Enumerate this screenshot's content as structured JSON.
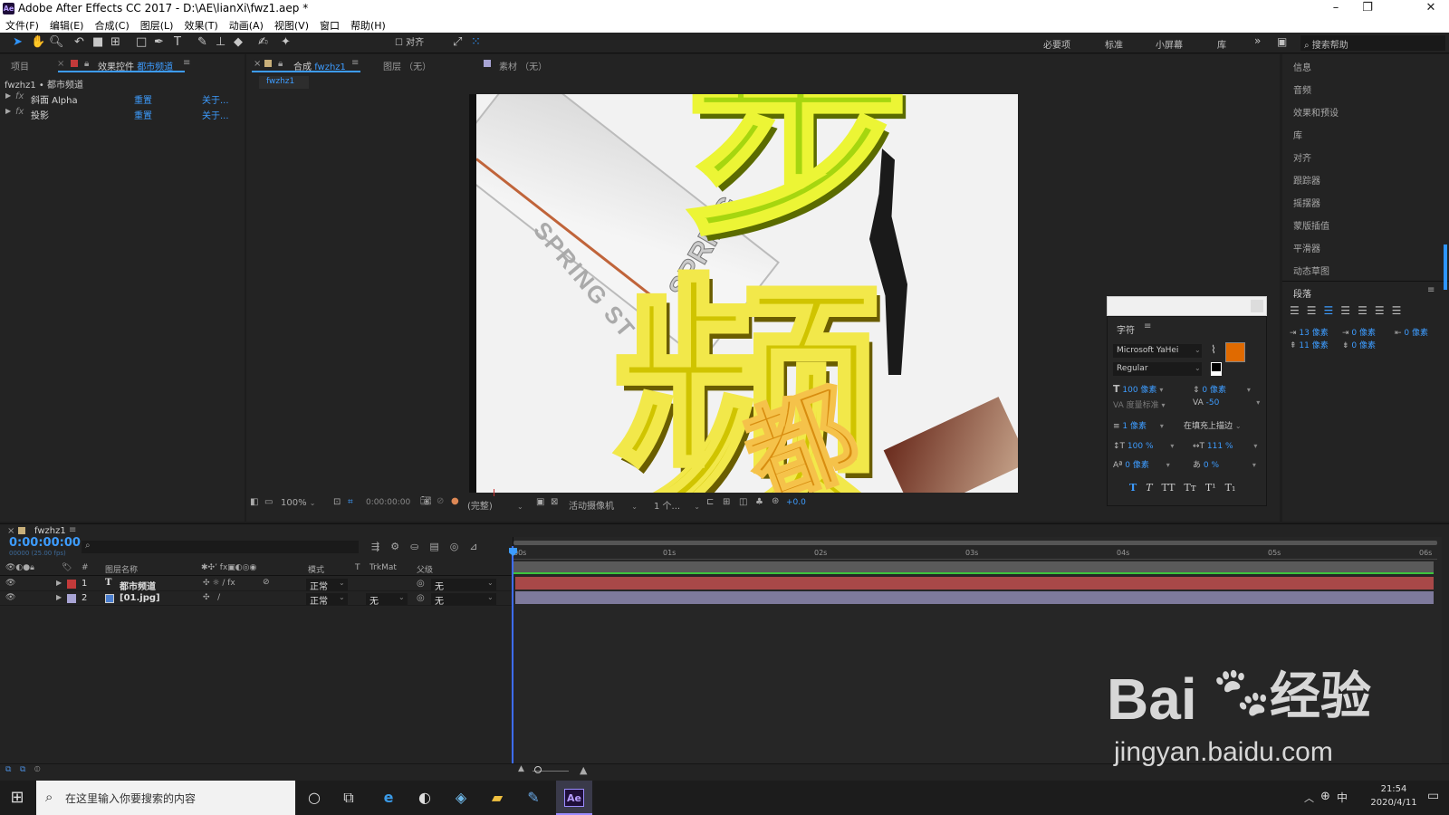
{
  "window": {
    "title": "Adobe After Effects CC 2017 - D:\\AE\\lianXi\\fwz1.aep *",
    "app_icon": "Ae",
    "controls": [
      "–",
      "❐",
      "✕"
    ]
  },
  "menu": [
    "文件(F)",
    "编辑(E)",
    "合成(C)",
    "图层(L)",
    "效果(T)",
    "动画(A)",
    "视图(V)",
    "窗口",
    "帮助(H)"
  ],
  "toolbar": {
    "align_label": "对齐",
    "workspaces": [
      "必要项",
      "标准",
      "小屏幕",
      "库"
    ],
    "search_placeholder": "搜索帮助"
  },
  "project_panel": {
    "tab_project": "项目",
    "tab_effects": "效果控件",
    "tab_effects_target": "都市频道",
    "breadcrumb": "fwzhz1 • 都市频道",
    "effects": [
      {
        "name": "斜面 Alpha",
        "reset": "重置",
        "about": "关于..."
      },
      {
        "name": "投影",
        "reset": "重置",
        "about": "关于..."
      }
    ]
  },
  "viewer": {
    "tab_comp": "合成",
    "tab_comp_name": "fwzhz1",
    "tab_layer": "图层 （无）",
    "tab_footage": "素材 （无）",
    "sub_tab": "fwzhz1",
    "canvas_text": {
      "big_top": "步",
      "big_mid": "频",
      "small": "都",
      "street": "SPRING ST",
      "sign": "SPRING"
    },
    "controls": {
      "zoom": "100%",
      "timecode": "0:00:00:00",
      "resolution": "(完整)",
      "camera": "活动摄像机",
      "views": "1 个...",
      "exposure": "+0.0"
    }
  },
  "right_panels": [
    "信息",
    "音频",
    "效果和预设",
    "库",
    "对齐",
    "跟踪器",
    "摇摆器",
    "蒙版插值",
    "平滑器",
    "动态草图"
  ],
  "paragraph": {
    "title": "段落",
    "indent_left": "13 像素",
    "indent_first": "0 像素",
    "indent_right": "0 像素",
    "space_before": "11 像素",
    "space_after": "0 像素"
  },
  "character": {
    "title": "字符",
    "font": "Microsoft YaHei",
    "style": "Regular",
    "size": "100 像素",
    "leading": "0 像素",
    "kerning": "度量标准",
    "tracking": "-50",
    "stroke_width": "1 像素",
    "stroke_mode": "在填充上描边",
    "vscale": "100 %",
    "hscale": "111 %",
    "baseline": "0 像素",
    "tsume": "0 %",
    "fill_color": "#e06a00",
    "stroke_color": "#ffe000",
    "format_buttons": [
      "T",
      "T",
      "TT",
      "Tт",
      "T¹",
      "T₁"
    ]
  },
  "timeline": {
    "comp_tab": "fwzhz1",
    "timecode": "0:00:00:00",
    "fps": "00000 (25.00 fps)",
    "headers": {
      "num": "#",
      "name": "图层名称",
      "mode": "模式",
      "t": "T",
      "trkmat": "TrkMat",
      "parent": "父级"
    },
    "ruler": [
      "00s",
      "01s",
      "02s",
      "03s",
      "04s",
      "05s",
      "06s"
    ],
    "layers": [
      {
        "num": "1",
        "type": "T",
        "name": "都市频道",
        "mode": "正常",
        "trkmat": "",
        "parent": "无",
        "color": "#c33a3a",
        "bar_color": "#a84848"
      },
      {
        "num": "2",
        "type": "img",
        "name": "[01.jpg]",
        "mode": "正常",
        "trkmat": "无",
        "parent": "无",
        "color": "#a8a4d4",
        "bar_color": "#7e7a9c"
      }
    ]
  },
  "taskbar": {
    "search_placeholder": "在这里输入你要搜索的内容",
    "time": "21:54",
    "date": "2020/4/11",
    "ime": "中",
    "ae_label": "Ae"
  },
  "watermark": {
    "line1": "Bai",
    "line2": "经验",
    "url": "jingyan.baidu.com"
  }
}
